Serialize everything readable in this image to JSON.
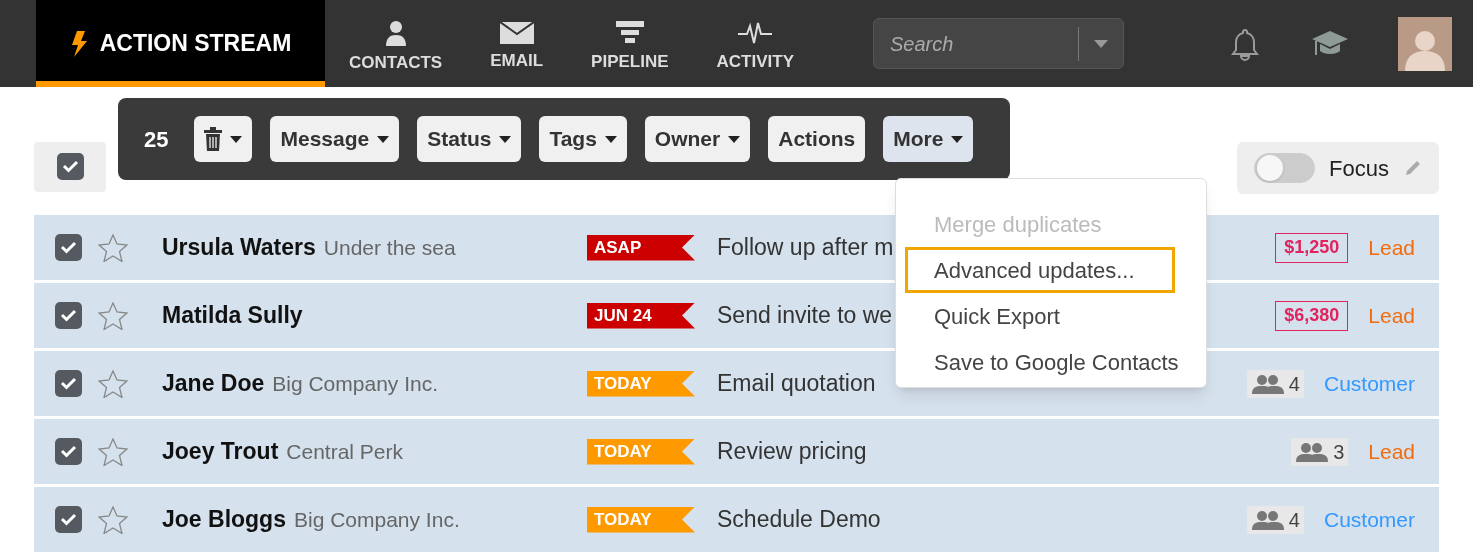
{
  "nav": [
    {
      "label": "ACTION STREAM",
      "kind": "bolt",
      "selected": true
    },
    {
      "label": "CONTACTS",
      "kind": "person",
      "selected": false
    },
    {
      "label": "EMAIL",
      "kind": "envelope",
      "selected": false
    },
    {
      "label": "PIPELINE",
      "kind": "funnel",
      "selected": false
    },
    {
      "label": "ACTIVITY",
      "kind": "pulse",
      "selected": false
    }
  ],
  "search": {
    "placeholder": "Search"
  },
  "bulk_toolbar": {
    "count": "25",
    "buttons": [
      {
        "kind": "trash",
        "dropdown": true,
        "selected": false
      },
      {
        "label": "Message",
        "dropdown": true,
        "selected": false
      },
      {
        "label": "Status",
        "dropdown": true,
        "selected": false
      },
      {
        "label": "Tags",
        "dropdown": true,
        "selected": false
      },
      {
        "label": "Owner",
        "dropdown": true,
        "selected": false
      },
      {
        "label": "Actions",
        "dropdown": false,
        "selected": false
      },
      {
        "label": "More",
        "dropdown": true,
        "selected": true
      }
    ]
  },
  "select_all": {
    "checked": true
  },
  "focus": {
    "label": "Focus",
    "on": false
  },
  "more_menu": [
    {
      "label": "Merge duplicates",
      "disabled": true,
      "selected": false
    },
    {
      "label": "Advanced updates...",
      "disabled": false,
      "selected": true
    },
    {
      "label": "Quick Export",
      "disabled": false,
      "selected": false
    },
    {
      "label": "Save to Google Contacts",
      "disabled": false,
      "selected": false
    }
  ],
  "rows": [
    {
      "checked": true,
      "starred": false,
      "name": "Ursula Waters",
      "company": "Under the sea",
      "tag": {
        "text": "ASAP",
        "color": "#cc0000"
      },
      "task": "Follow up after m",
      "deal": "$1,250",
      "status": {
        "text": "Lead",
        "color": "#f26c0d"
      }
    },
    {
      "checked": true,
      "starred": false,
      "name": "Matilda Sully",
      "tag": {
        "text": "JUN 24",
        "color": "#cc0000"
      },
      "task": "Send invite to we",
      "deal": "$6,380",
      "status": {
        "text": "Lead",
        "color": "#f26c0d"
      }
    },
    {
      "checked": true,
      "starred": false,
      "name": "Jane Doe",
      "company": "Big Company Inc.",
      "tag": {
        "text": "TODAY",
        "color": "#ff9900"
      },
      "task": "Email quotation",
      "contacts": "4",
      "status": {
        "text": "Customer",
        "color": "#3399ff"
      }
    },
    {
      "checked": true,
      "starred": false,
      "name": "Joey Trout",
      "company": "Central Perk",
      "tag": {
        "text": "TODAY",
        "color": "#ff9900"
      },
      "task": "Review pricing",
      "contacts": "3",
      "status": {
        "text": "Lead",
        "color": "#f26c0d"
      }
    },
    {
      "checked": true,
      "starred": false,
      "name": "Joe Bloggs",
      "company": "Big Company Inc.",
      "tag": {
        "text": "TODAY",
        "color": "#ff9900"
      },
      "task": "Schedule Demo",
      "contacts": "4",
      "status": {
        "text": "Customer",
        "color": "#3399ff"
      }
    }
  ]
}
